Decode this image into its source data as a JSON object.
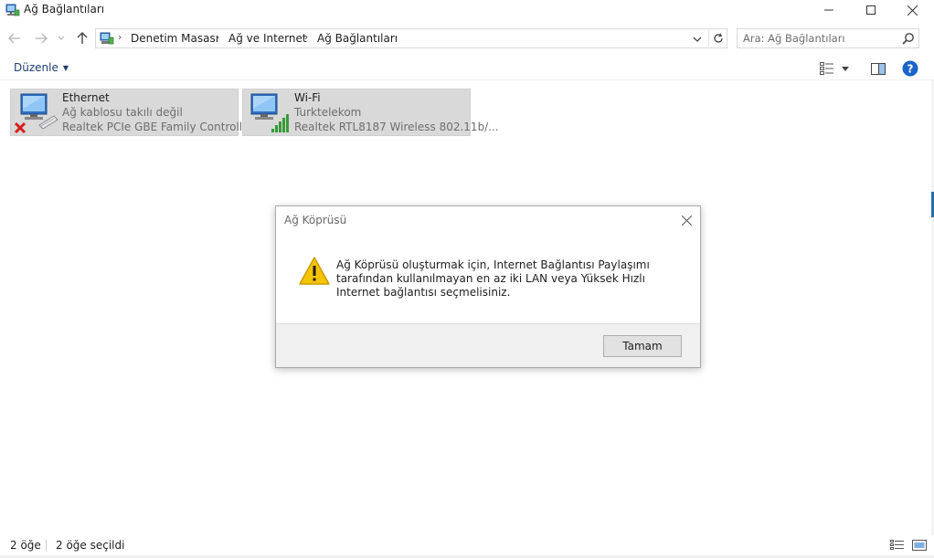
{
  "window": {
    "title": "Ağ Bağlantıları"
  },
  "address": {
    "crumbs": [
      "Denetim Masası",
      "Ağ ve Internet",
      "Ağ Bağlantıları"
    ]
  },
  "search": {
    "placeholder": "Ara: Ağ Bağlantıları"
  },
  "toolbar": {
    "organize_label": "Düzenle"
  },
  "connections": [
    {
      "name": "Ethernet",
      "status": "Ağ kablosu takılı değil",
      "device": "Realtek PCIe GBE Family Controller",
      "icon": "ethernet-disconnected-icon"
    },
    {
      "name": "Wi-Fi",
      "status": "Turktelekom",
      "device": "Realtek RTL8187 Wireless 802.11b/...",
      "icon": "wifi-signal-icon"
    }
  ],
  "dialog": {
    "title": "Ağ Köprüsü",
    "message": "Ağ Köprüsü oluşturmak için, Internet Bağlantısı Paylaşımı tarafından kullanılmayan en az iki LAN veya Yüksek Hızlı Internet bağlantısı seçmelisiniz.",
    "ok_label": "Tamam",
    "icon": "warning-icon"
  },
  "statusbar": {
    "item_count": "2 öğe",
    "selected_count": "2 öğe seçildi"
  },
  "colors": {
    "accent": "#1e3f6f",
    "tile_selected": "#d9d9d9",
    "help_blue": "#1a64c8",
    "warning_yellow": "#f5c400"
  }
}
